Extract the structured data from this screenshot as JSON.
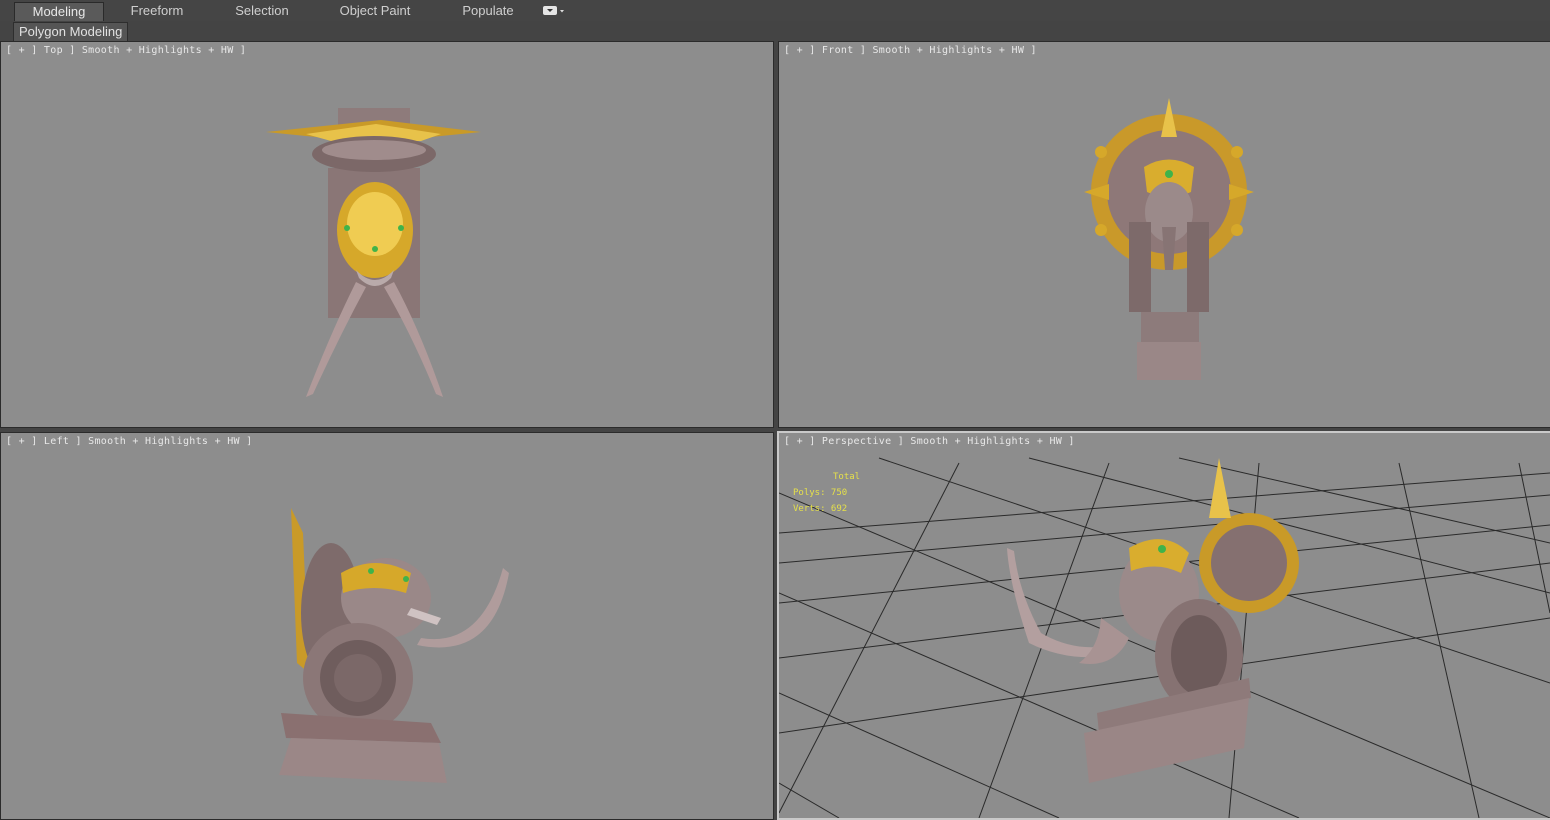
{
  "ribbon": {
    "tabs": [
      {
        "label": "Modeling",
        "active": true
      },
      {
        "label": "Freeform",
        "active": false
      },
      {
        "label": "Selection",
        "active": false
      },
      {
        "label": "Object Paint",
        "active": false
      },
      {
        "label": "Populate",
        "active": false
      }
    ],
    "sub_tab": "Polygon Modeling"
  },
  "viewports": {
    "top": {
      "label": "[ + ] Top ] Smooth + Highlights + HW ]"
    },
    "front": {
      "label": "[ + ] Front ] Smooth + Highlights + HW ]"
    },
    "left": {
      "label": "[ + ] Left ] Smooth + Highlights + HW ]"
    },
    "perspective": {
      "label": "[ + ] Perspective ] Smooth + Highlights + HW ]",
      "stats": {
        "header": "Total",
        "polys": "Polys: 750",
        "verts": "Verts: 692"
      }
    }
  },
  "colors": {
    "viewport_bg": "#8d8d8d",
    "gold": "#d9a92c",
    "stone": "#8c7a7a",
    "gem": "#3fb34a"
  }
}
